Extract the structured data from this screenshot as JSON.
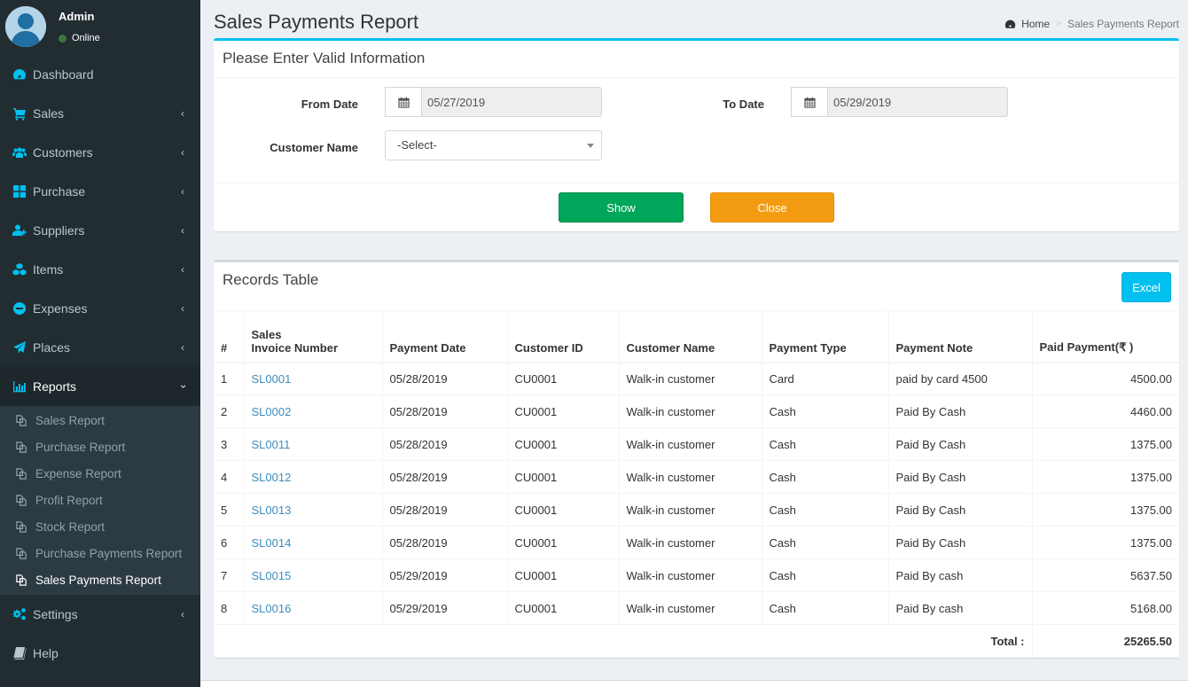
{
  "user": {
    "name": "Admin",
    "status": "Online"
  },
  "sidebar": {
    "items": [
      {
        "label": "Dashboard",
        "icon": "dashboard-icon",
        "has_children": false
      },
      {
        "label": "Sales",
        "icon": "cart-icon",
        "has_children": true
      },
      {
        "label": "Customers",
        "icon": "users-icon",
        "has_children": true
      },
      {
        "label": "Purchase",
        "icon": "grid-icon",
        "has_children": true
      },
      {
        "label": "Suppliers",
        "icon": "user-plus-icon",
        "has_children": true
      },
      {
        "label": "Items",
        "icon": "cubes-icon",
        "has_children": true
      },
      {
        "label": "Expenses",
        "icon": "minus-circle-icon",
        "has_children": true
      },
      {
        "label": "Places",
        "icon": "paper-plane-icon",
        "has_children": true
      },
      {
        "label": "Reports",
        "icon": "bar-chart-icon",
        "has_children": true,
        "expanded": true
      },
      {
        "label": "Settings",
        "icon": "cogs-icon",
        "has_children": true
      },
      {
        "label": "Help",
        "icon": "book-icon",
        "has_children": false
      }
    ],
    "reports_submenu": [
      {
        "label": "Sales Report"
      },
      {
        "label": "Purchase Report"
      },
      {
        "label": "Expense Report"
      },
      {
        "label": "Profit Report"
      },
      {
        "label": "Stock Report"
      },
      {
        "label": "Purchase Payments Report"
      },
      {
        "label": "Sales Payments Report",
        "active": true
      }
    ]
  },
  "header": {
    "title": "Sales Payments Report",
    "breadcrumb": {
      "home": "Home",
      "separator": ">",
      "current": "Sales Payments Report"
    }
  },
  "form": {
    "title": "Please Enter Valid Information",
    "from_date_label": "From Date",
    "from_date_value": "05/27/2019",
    "to_date_label": "To Date",
    "to_date_value": "05/29/2019",
    "customer_label": "Customer Name",
    "customer_selected": "-Select-",
    "show_label": "Show",
    "close_label": "Close"
  },
  "records": {
    "title": "Records Table",
    "excel_label": "Excel",
    "columns": [
      "#",
      "Sales",
      "Invoice Number",
      "Payment Date",
      "Customer ID",
      "Customer Name",
      "Payment Type",
      "Payment Note",
      "Paid Payment(₹ )"
    ],
    "rows": [
      {
        "n": "1",
        "invoice": "SL0001",
        "date": "05/28/2019",
        "cid": "CU0001",
        "cname": "Walk-in customer",
        "type": "Card",
        "note": "paid by card 4500",
        "amount": "4500.00"
      },
      {
        "n": "2",
        "invoice": "SL0002",
        "date": "05/28/2019",
        "cid": "CU0001",
        "cname": "Walk-in customer",
        "type": "Cash",
        "note": "Paid By Cash",
        "amount": "4460.00"
      },
      {
        "n": "3",
        "invoice": "SL0011",
        "date": "05/28/2019",
        "cid": "CU0001",
        "cname": "Walk-in customer",
        "type": "Cash",
        "note": "Paid By Cash",
        "amount": "1375.00"
      },
      {
        "n": "4",
        "invoice": "SL0012",
        "date": "05/28/2019",
        "cid": "CU0001",
        "cname": "Walk-in customer",
        "type": "Cash",
        "note": "Paid By Cash",
        "amount": "1375.00"
      },
      {
        "n": "5",
        "invoice": "SL0013",
        "date": "05/28/2019",
        "cid": "CU0001",
        "cname": "Walk-in customer",
        "type": "Cash",
        "note": "Paid By Cash",
        "amount": "1375.00"
      },
      {
        "n": "6",
        "invoice": "SL0014",
        "date": "05/28/2019",
        "cid": "CU0001",
        "cname": "Walk-in customer",
        "type": "Cash",
        "note": "Paid By Cash",
        "amount": "1375.00"
      },
      {
        "n": "7",
        "invoice": "SL0015",
        "date": "05/29/2019",
        "cid": "CU0001",
        "cname": "Walk-in customer",
        "type": "Cash",
        "note": "Paid By cash",
        "amount": "5637.50"
      },
      {
        "n": "8",
        "invoice": "SL0016",
        "date": "05/29/2019",
        "cid": "CU0001",
        "cname": "Walk-in customer",
        "type": "Cash",
        "note": "Paid By cash",
        "amount": "5168.00"
      }
    ],
    "total_label": "Total :",
    "total_value": "25265.50"
  },
  "colors": {
    "sidebar_bg": "#222d32",
    "accent": "#00c0ef",
    "show_button": "#00a65a",
    "close_button": "#f39c12",
    "link": "#3c8dbc"
  }
}
